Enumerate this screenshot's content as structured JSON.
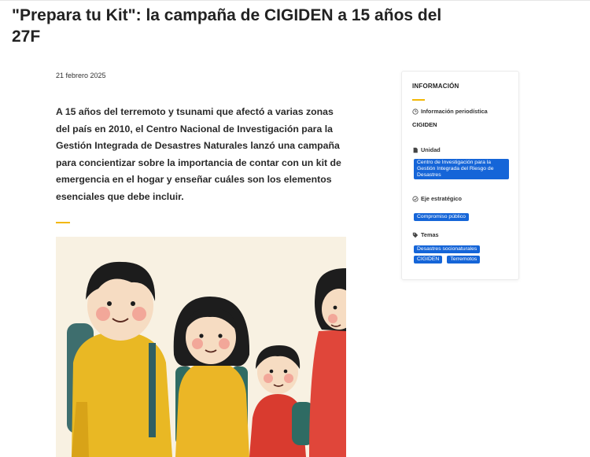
{
  "article": {
    "title": "\"Prepara tu Kit\": la campaña de CIGIDEN a 15 años del 27F",
    "date": "21 febrero 2025",
    "lead": "A 15 años del terremoto y tsunami que afectó a varias zonas del país en 2010, el Centro Nacional de Investigación para la Gestión Integrada de Desastres Naturales lanzó una campaña para concientizar sobre la importancia de contar con un kit de emergencia en el hogar y enseñar cuáles son los elementos esenciales que debe incluir."
  },
  "sidebar": {
    "heading": "INFORMACIÓN",
    "info_type": {
      "label": "Información periodística",
      "value": "CIGIDEN",
      "icon": "clock-icon"
    },
    "unit": {
      "label": "Unidad",
      "tag": "Centro de Investigación para la Gestión Integrada del Riesgo de Desastres",
      "icon": "document-icon"
    },
    "axis": {
      "label": "Eje estratégico",
      "tag": "Compromiso público",
      "icon": "check-circle-icon"
    },
    "topics": {
      "label": "Temas",
      "tags": [
        "Desastres socionaturales",
        "CIGIDEN",
        "Terremotos"
      ],
      "icon": "tag-icon"
    }
  },
  "colors": {
    "accent": "#f2b705",
    "tag_blue": "#1565d8",
    "illustration_bg": "#f8f1e2"
  }
}
